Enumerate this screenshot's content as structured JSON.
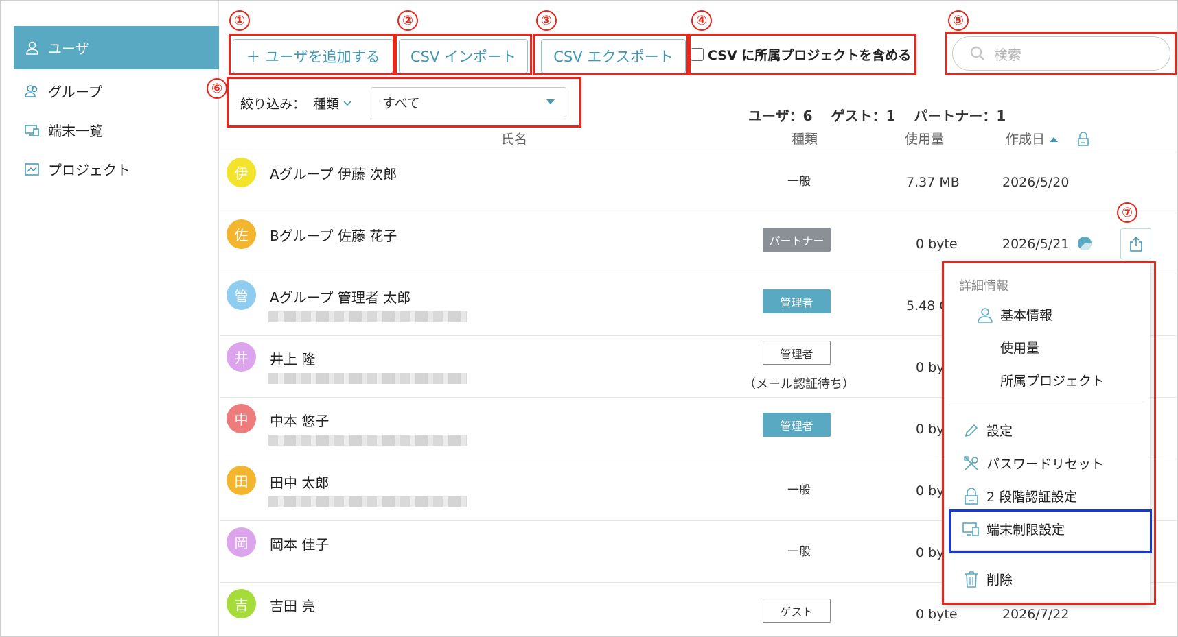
{
  "sidebar": {
    "items": [
      {
        "label": "ユーザ",
        "icon": "user-icon"
      },
      {
        "label": "グループ",
        "icon": "group-icon"
      },
      {
        "label": "端末一覧",
        "icon": "device-icon"
      },
      {
        "label": "プロジェクト",
        "icon": "project-icon"
      }
    ]
  },
  "toolbar": {
    "add_user": "＋ ユーザを追加する",
    "csv_import": "CSV インポート",
    "csv_export": "CSV エクスポート",
    "csv_include_label": "CSV に所属プロジェクトを含める",
    "csv_include_checked": false
  },
  "search": {
    "placeholder": "検索"
  },
  "filter": {
    "label": "絞り込み：",
    "kind": "種類",
    "selected": "すべて"
  },
  "counts": "ユーザ：6　 ゲスト：1　 パートナー：1",
  "columns": {
    "name": "氏名",
    "kind": "種類",
    "usage": "使用量",
    "created": "作成日"
  },
  "annotations": [
    "①",
    "②",
    "③",
    "④",
    "⑤",
    "⑥",
    "⑦"
  ],
  "users": [
    {
      "avatar": "伊",
      "color": "#f3e32a",
      "name": "Aグループ 伊藤 次郎",
      "kind": "一般",
      "usage": "7.37 MB",
      "date": "2026/5/20"
    },
    {
      "avatar": "佐",
      "color": "#f4b52e",
      "name": "Bグループ 佐藤 花子",
      "kind": "パートナー",
      "usage": "0 byte",
      "date": "2026/5/21"
    },
    {
      "avatar": "管",
      "color": "#8fcdf0",
      "name": "Aグループ 管理者 太郎",
      "kind": "管理者",
      "usage": "5.48 G",
      "date": ""
    },
    {
      "avatar": "井",
      "color": "#dda4ee",
      "name": "井上 隆",
      "kind": "管理者",
      "kind_note": "（メール認証待ち）",
      "usage": "0 by",
      "date": ""
    },
    {
      "avatar": "中",
      "color": "#ee7c7c",
      "name": "中本 悠子",
      "kind": "管理者",
      "usage": "0 by",
      "date": ""
    },
    {
      "avatar": "田",
      "color": "#f4b52e",
      "name": "田中 太郎",
      "kind": "一般",
      "usage": "0 by",
      "date": ""
    },
    {
      "avatar": "岡",
      "color": "#dda4ee",
      "name": "岡本 佳子",
      "kind": "一般",
      "usage": "0 by",
      "date": ""
    },
    {
      "avatar": "吉",
      "color": "#a6dc3a",
      "name": "吉田 亮",
      "kind": "ゲスト",
      "usage": "0 byte",
      "date": "2026/7/22"
    }
  ],
  "menu": {
    "header": "詳細情報",
    "items": {
      "basic": "基本情報",
      "usage": "使用量",
      "projects": "所属プロジェクト",
      "settings": "設定",
      "password_reset": "パスワードリセット",
      "two_factor": "2 段階認証設定",
      "device_limit": "端末制限設定",
      "delete": "削除"
    }
  }
}
